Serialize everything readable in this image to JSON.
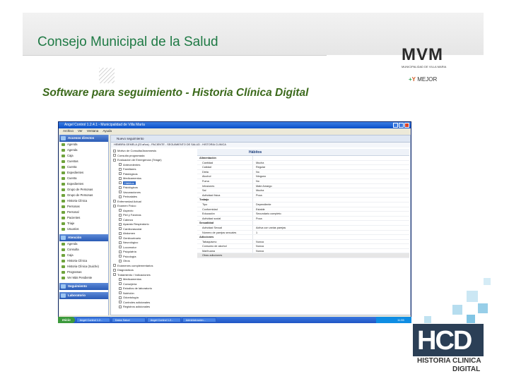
{
  "slide": {
    "title": "Consejo Municipal de la Salud",
    "subtitle": "Software para seguimiento - Historia Clínica Digital"
  },
  "logos": {
    "mvm": "MVM",
    "mvm_small": "MUNICIPALIDAD DE VILLA MARIA",
    "slogan_plus": "+",
    "slogan_y": "Y",
    "slogan_rest": "MEJOR",
    "hcd": "HCD",
    "hcd_line1": "HISTORIA CLINICA",
    "hcd_line2": "DIGITAL"
  },
  "colors": {
    "title_green": "#1f7a45",
    "subtitle_green": "#3c6a1c",
    "hcd_blue": "#2f9ed2",
    "hcd_dark": "#2b3f56"
  },
  "app": {
    "window_title": "Angel Control 1.2.4.1 - Municipalidad de Villa María",
    "menu": [
      "Archivo",
      "Ver",
      "Ventana",
      "Ayuda"
    ],
    "content_header": "Nuevo seguimiento",
    "patient_bar": "HEMBRA GEMELA (23 años) - PACIENTE - SEGUIMIENTO DE SALUD - HISTORIA CLINICA",
    "detail_title": "Hábitos",
    "nav": {
      "section1": "Accesos directos",
      "items1": [
        "Agenda",
        "Agenda",
        "Caja",
        "Cuentas",
        "Cuenta",
        "Expedientes",
        "Cuenta",
        "Expedientes",
        "Grupo de Personas",
        "Grupo de Personas",
        "Historia Clínica",
        "Personas",
        "Personal",
        "Pacientes",
        "Triaje",
        "Usuarios"
      ],
      "section2": "Atención",
      "items2": [
        "Agenda",
        "Consulta",
        "Caja",
        "Historia Clínica",
        "Historia Clínica (Suiche)",
        "Programas",
        "Ver Más Pendiente"
      ],
      "section3": "Seguimiento",
      "section4": "Laboratorio"
    },
    "tree": [
      {
        "label": "Motivo de Consulta/Anamnesis",
        "sel": false
      },
      {
        "label": "Consulta programada",
        "sel": false
      },
      {
        "label": "Evaluación de Emergencia (Triage)",
        "sel": false
      },
      {
        "label": "Antecedentes",
        "sel": false
      },
      {
        "label": "Familiares",
        "sel": false
      },
      {
        "label": "Patológicos",
        "sel": false
      },
      {
        "label": "Medicamentos",
        "sel": false
      },
      {
        "label": "Hábitos",
        "sel": true
      },
      {
        "label": "Fisiológicos",
        "sel": false
      },
      {
        "label": "Vacunaciones",
        "sel": false
      },
      {
        "label": "Perinatales",
        "sel": false
      },
      {
        "label": "Enfermedad Actual",
        "sel": false
      },
      {
        "label": "Examen Físico",
        "sel": false
      },
      {
        "label": "Aspecto",
        "sel": false
      },
      {
        "label": "Piel y Faneras",
        "sel": false
      },
      {
        "label": "Cabeza",
        "sel": false
      },
      {
        "label": "Aparato Respiratorio",
        "sel": false
      },
      {
        "label": "Cardiovascular",
        "sel": false
      },
      {
        "label": "Abdomen",
        "sel": false
      },
      {
        "label": "Genitourinario",
        "sel": false
      },
      {
        "label": "Neurológico",
        "sel": false
      },
      {
        "label": "Locomotor",
        "sel": false
      },
      {
        "label": "Psiquiatría",
        "sel": false
      },
      {
        "label": "Psicología",
        "sel": false
      },
      {
        "label": "Otros",
        "sel": false
      },
      {
        "label": "Exámenes complementarios",
        "sel": false
      },
      {
        "label": "Diagnósticos",
        "sel": false
      },
      {
        "label": "Tratamiento / Indicaciones",
        "sel": false
      },
      {
        "label": "Medicamentos",
        "sel": false
      },
      {
        "label": "Consejería",
        "sel": false
      },
      {
        "label": "Estudios de laboratorio",
        "sel": false
      },
      {
        "label": "Nutrición",
        "sel": false
      },
      {
        "label": "Odontología",
        "sel": false
      },
      {
        "label": "Controles adicionales",
        "sel": false
      },
      {
        "label": "Registros adicionales",
        "sel": false
      }
    ],
    "rows": [
      {
        "k": "Alimentación",
        "v": "",
        "section": true
      },
      {
        "k": "Cantidad",
        "v": "Mucha"
      },
      {
        "k": "Calidad",
        "v": "Regular"
      },
      {
        "k": "Dieta",
        "v": "No"
      },
      {
        "k": "Alcohol",
        "v": "Ninguno"
      },
      {
        "k": "Fuma",
        "v": "No"
      },
      {
        "k": "Infusiones",
        "v": "Mate Amargo"
      },
      {
        "k": "Sal",
        "v": "Mucha"
      },
      {
        "k": "Actividad física",
        "v": "Poca"
      },
      {
        "k": "Trabajo",
        "v": "",
        "section": true
      },
      {
        "k": "Tipo",
        "v": "Dependiente"
      },
      {
        "k": "Conformidad",
        "v": "Estable"
      },
      {
        "k": "Educación",
        "v": "Secundario completo"
      },
      {
        "k": "Actividad social",
        "v": "Poca"
      },
      {
        "k": "Sexualidad",
        "v": "",
        "section": true
      },
      {
        "k": "Actividad Sexual",
        "v": "Activa con varias parejas"
      },
      {
        "k": "Número de parejas sexuales",
        "v": "1"
      },
      {
        "k": "Adicciones",
        "v": "",
        "section": true
      },
      {
        "k": "Tabaquismo",
        "v": "Nunca"
      },
      {
        "k": "Consumo de alcohol",
        "v": "Nunca"
      },
      {
        "k": "Marihuana",
        "v": "Nunca"
      },
      {
        "k": "Otras adicciones",
        "v": "",
        "hl": true
      }
    ],
    "taskbar": {
      "start": "Inicio",
      "tasks": [
        "Angel Control 1.2...",
        "Datos Salud",
        "Angel Control 1.2...",
        "Administración..."
      ],
      "clock": "11:55"
    }
  }
}
